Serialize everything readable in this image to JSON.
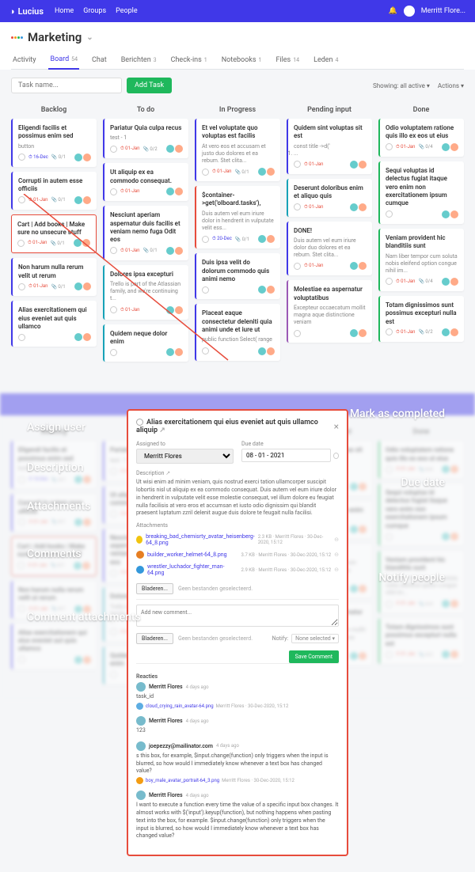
{
  "brand": "Lucius",
  "topnav": [
    "Home",
    "Groups",
    "People"
  ],
  "user": "Merritt Flore...",
  "page_title": "Marketing",
  "tabs": [
    {
      "label": "Activity",
      "badge": ""
    },
    {
      "label": "Board",
      "badge": "54",
      "active": true
    },
    {
      "label": "Chat",
      "badge": ""
    },
    {
      "label": "Berichten",
      "badge": "3"
    },
    {
      "label": "Check-ins",
      "badge": "1"
    },
    {
      "label": "Notebooks",
      "badge": "1"
    },
    {
      "label": "Files",
      "badge": "14"
    },
    {
      "label": "Leden",
      "badge": "4"
    }
  ],
  "task_placeholder": "Task name...",
  "add_task": "Add Task",
  "showing": "Showing: all active",
  "actions": "Actions",
  "columns": [
    {
      "name": "Backlog",
      "cards": [
        {
          "title": "Eligendi facilis et possimus enim sed",
          "desc": "button",
          "date": "16-Dec",
          "badge": "0/1",
          "color": ""
        },
        {
          "title": "Corrupti in autem esse officiis",
          "date": "01-Jan",
          "badge": "0/1",
          "color": ""
        },
        {
          "title": "Cart | Add books | Make sure no unsecure stuff",
          "date": "01-Jan",
          "badge": "0/1",
          "color": "red",
          "hl": true
        },
        {
          "title": "Non harum nulla rerum velit ut rerum",
          "date": "01-Jan",
          "badge": "0/1",
          "color": ""
        },
        {
          "title": "Alias exercitationem qui eius eveniet aut quis ullamco",
          "color": ""
        }
      ]
    },
    {
      "name": "To do",
      "cards": [
        {
          "title": "Pariatur Quia culpa recus",
          "desc": "test - 1",
          "date": "01-Jan",
          "badge": "0/2",
          "color": ""
        },
        {
          "title": "Ut aliquip ex ea commodo consequat.",
          "date": "01-Jan",
          "color": ""
        },
        {
          "title": "Nesciunt aperiam aspernatur duis facilis et veniam nemo fuga Odit eos",
          "date": "01-Jan",
          "badge": "0/1",
          "color": ""
        },
        {
          "title": "Dolores ipsa excepturi",
          "desc": "Trello is part of the Atlassian family, and we're continuing t...",
          "date": "01-Jan",
          "color": "cyan"
        },
        {
          "title": "Quidem neque dolor enim",
          "color": "cyan"
        }
      ]
    },
    {
      "name": "In Progress",
      "cards": [
        {
          "title": "Et vel voluptate quo voluptas est facilis",
          "desc": "At vero eos et accusam et justo duo dolores et ea rebum. Stet clita...",
          "date": "01-Jan",
          "badge": "0/1",
          "color": ""
        },
        {
          "title": "$container->get('olboard.tasks'),",
          "desc": "Duis autem vel eum iriure dolor in hendrerit in vulputate velit ess...",
          "date": "20-Dec",
          "badge": "0/1",
          "color": "red"
        },
        {
          "title": "Duis ipsa velit do dolorum commodo quis animi nemo",
          "color": ""
        },
        {
          "title": "Placeat eaque consectetur deleniti quia animi unde et iure ut",
          "desc": "public function Select( range",
          "color": ""
        }
      ]
    },
    {
      "name": "Pending input",
      "cards": [
        {
          "title": "Quidem sint voluptas sit est",
          "desc": "const title ->d('<ol><li>...",
          "date": "01-Jan",
          "color": ""
        },
        {
          "title": "Deserunt doloribus enim et aliquo quis",
          "date": "01-Jan",
          "color": "cyan"
        },
        {
          "title": "DONE!",
          "desc": "Duis autem vel eum iriure dolor duo dolores et ea rebum. Stet clita...",
          "date": "01-Jan",
          "color": ""
        },
        {
          "title": "Molestiae ea aspernatur voluptatibus",
          "desc": "Excepteur occaecatum mollit magna aque distinctione veniam",
          "color": "purple"
        }
      ]
    },
    {
      "name": "Done",
      "cards": [
        {
          "title": "Odio voluptatem ratione quis illo ex eos ut eius",
          "date": "01-Jan",
          "badge": "0/4",
          "color": "green"
        },
        {
          "title": "Sequi voluptas id delectus fugiat itaque vero enim non exercitationem ipsum cumque",
          "color": "green"
        },
        {
          "title": "Veniam provident hic blanditiis sunt",
          "desc": "Nam liber tempor cum soluta nobis eleifend option congue nihil im...",
          "date": "01-Jan",
          "badge": "0/4",
          "color": "green"
        },
        {
          "title": "Totam dignissimos sunt possimus excepturi nulla est",
          "date": "01-Jan",
          "badge": "0/2",
          "color": "green"
        }
      ]
    }
  ],
  "modal": {
    "title": "Alias exercitationem qui eius eveniet aut quis ullamco aliquip",
    "assigned_label": "Assigned to",
    "assigned_value": "Merritt Flores",
    "due_label": "Due date",
    "due_value": "08 - 01 - 2021",
    "desc_label": "Description",
    "desc_text": "Ut wisi enim ad minim veniam, quis nostrud exerci tation ullamcorper suscipit lobortis nisl ut aliquip ex ea commodo consequat. Duis autem vel eum iriure dolor in hendrerit in vulputate velit esse molestie consequat, vel illum dolore eu feugiat nulla facilisis at vero eros et accumsan et iusto odio dignissim qui blandit praesent luptatum zzril delenit augue duis dolore te feugait nulla facilisi.",
    "attach_label": "Attachments",
    "attachments": [
      {
        "name": "breaking_bad_chemisrty_avatar_heisenberg-64_8.png",
        "size": "2.3 KB",
        "user": "Merritt Flores",
        "date": "30-Dec-2020, 15:12",
        "c": "#f1c40f"
      },
      {
        "name": "builder_worker_helmet-64_8.png",
        "size": "3.7 KB",
        "user": "Merritt Flores",
        "date": "30-Dec-2020, 15:12",
        "c": "#e67e22"
      },
      {
        "name": "wrestler_luchador_fighter_man-64.png",
        "size": "2.9 KB",
        "user": "Merritt Flores",
        "date": "30-Dec-2020, 15:12",
        "c": "#3498db"
      }
    ],
    "browse": "Bladeren...",
    "no_files": "Geen bestanden geselecteerd.",
    "comment_placeholder": "Add new comment...",
    "notify_label": "Notify:",
    "notify_value": "None selected",
    "save_comment": "Save Comment",
    "reactions_label": "Reacties",
    "comments": [
      {
        "author": "Merritt Flores",
        "date": "4 days ago",
        "body": "task_id",
        "attach": {
          "name": "cloud_crying_rain_avatar-64.png",
          "meta": "Merritt Flores · 30-Dec-2020, 15:12",
          "c": "#5dade2"
        }
      },
      {
        "author": "Merritt Flores",
        "date": "4 days ago",
        "body": "123"
      },
      {
        "author": "joepezzy@mailinator.com",
        "date": "4 days ago",
        "body": "s this box, for example, $input.change(function) only triggers when the input is blurred, so how would I immediately know whenever a text box has changed value?",
        "attach": {
          "name": "boy_male_avatar_portrait-64_3.png",
          "meta": "Merritt Flores · 30-Dec-2020, 15:12",
          "c": "#f39c12"
        }
      },
      {
        "author": "Merritt Flores",
        "date": "4 days ago",
        "body": "I want to execute a function every time the value of a specific input box changes. It almost works with $('input').keyup(function), but nothing happens when pasting text into the box, for example. $input.change(function) only triggers when the input is blurred, so how would I immediately know whenever a text box has changed value?"
      }
    ]
  },
  "annotations": {
    "assign": "Assign user",
    "desc": "Description",
    "attach": "Attachments",
    "comments": "Comments",
    "cattach": "Comment attachments",
    "mark": "Mark as completed",
    "due": "Due date",
    "notify": "Notify people"
  }
}
